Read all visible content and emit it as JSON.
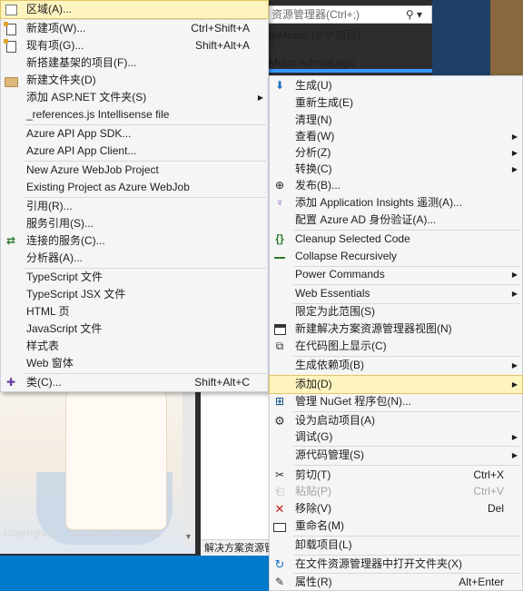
{
  "background": {
    "copyright_text": "Copyright © ... All Rights Reserved",
    "solution_explorer": {
      "search_placeholder": "资源管理器(Ctrl+;)",
      "solution_line": "grMotor' (9 个项目)",
      "project_line": "Motor.AdminLogic",
      "bottom_tab": "解决方案资源管"
    }
  },
  "add_submenu": {
    "items": [
      {
        "label": "区域(A)...",
        "shortcut": "",
        "icon": "area-icon",
        "highlighted": true
      },
      {
        "label": "新建项(W)...",
        "shortcut": "Ctrl+Shift+A",
        "icon": "new-item-icon"
      },
      {
        "label": "现有项(G)...",
        "shortcut": "Shift+Alt+A",
        "icon": "existing-item-icon"
      },
      {
        "label": "新搭建基架的项目(F)...",
        "shortcut": ""
      },
      {
        "label": "新建文件夹(D)",
        "shortcut": "",
        "icon": "folder-icon"
      },
      {
        "label": "添加 ASP.NET 文件夹(S)",
        "shortcut": "",
        "submenu": true
      },
      {
        "label": "_references.js Intellisense file",
        "shortcut": ""
      },
      {
        "label": "Azure API App SDK...",
        "shortcut": ""
      },
      {
        "label": "Azure API App Client...",
        "shortcut": ""
      },
      {
        "label": "New Azure WebJob Project",
        "shortcut": ""
      },
      {
        "label": "Existing Project as Azure WebJob",
        "shortcut": ""
      },
      {
        "label": "引用(R)...",
        "shortcut": ""
      },
      {
        "label": "服务引用(S)...",
        "shortcut": ""
      },
      {
        "label": "连接的服务(C)...",
        "shortcut": "",
        "icon": "connected-services-icon"
      },
      {
        "label": "分析器(A)...",
        "shortcut": ""
      },
      {
        "label": "TypeScript 文件",
        "shortcut": ""
      },
      {
        "label": "TypeScript JSX 文件",
        "shortcut": ""
      },
      {
        "label": "HTML 页",
        "shortcut": ""
      },
      {
        "label": "JavaScript 文件",
        "shortcut": ""
      },
      {
        "label": "样式表",
        "shortcut": ""
      },
      {
        "label": "Web 窗体",
        "shortcut": ""
      },
      {
        "label": "类(C)...",
        "shortcut": "Shift+Alt+C",
        "icon": "class-icon"
      }
    ]
  },
  "project_context_menu": {
    "items": [
      {
        "label": "生成(U)",
        "icon": "build-icon"
      },
      {
        "label": "重新生成(E)"
      },
      {
        "label": "清理(N)"
      },
      {
        "label": "查看(W)",
        "submenu": true
      },
      {
        "label": "分析(Z)",
        "submenu": true
      },
      {
        "label": "转换(C)",
        "submenu": true
      },
      {
        "label": "发布(B)...",
        "icon": "publish-icon"
      },
      {
        "label": "添加 Application Insights 遥测(A)...",
        "icon": "insights-icon"
      },
      {
        "label": "配置 Azure AD 身份验证(A)..."
      },
      {
        "label": "Cleanup Selected Code",
        "icon": "braces-icon"
      },
      {
        "label": "Collapse Recursively",
        "icon": "collapse-icon"
      },
      {
        "label": "Power Commands",
        "submenu": true
      },
      {
        "label": "Web Essentials",
        "submenu": true
      },
      {
        "label": "限定为此范围(S)"
      },
      {
        "label": "新建解决方案资源管理器视图(N)",
        "icon": "new-view-icon"
      },
      {
        "label": "在代码图上显示(C)",
        "icon": "code-map-icon"
      },
      {
        "label": "生成依赖项(B)",
        "submenu": true
      },
      {
        "label": "添加(D)",
        "submenu": true,
        "highlighted": true
      },
      {
        "label": "管理 NuGet 程序包(N)...",
        "icon": "nuget-icon"
      },
      {
        "label": "设为启动项目(A)",
        "icon": "gear-icon"
      },
      {
        "label": "调试(G)",
        "submenu": true
      },
      {
        "label": "源代码管理(S)",
        "submenu": true
      },
      {
        "label": "剪切(T)",
        "shortcut": "Ctrl+X",
        "icon": "cut-icon"
      },
      {
        "label": "粘贴(P)",
        "shortcut": "Ctrl+V",
        "icon": "paste-icon",
        "disabled": true
      },
      {
        "label": "移除(V)",
        "shortcut": "Del",
        "icon": "remove-icon"
      },
      {
        "label": "重命名(M)",
        "icon": "rename-icon"
      },
      {
        "label": "卸载项目(L)"
      },
      {
        "label": "在文件资源管理器中打开文件夹(X)",
        "icon": "open-folder-icon"
      },
      {
        "label": "属性(R)",
        "shortcut": "Alt+Enter",
        "icon": "wrench-icon"
      }
    ]
  }
}
